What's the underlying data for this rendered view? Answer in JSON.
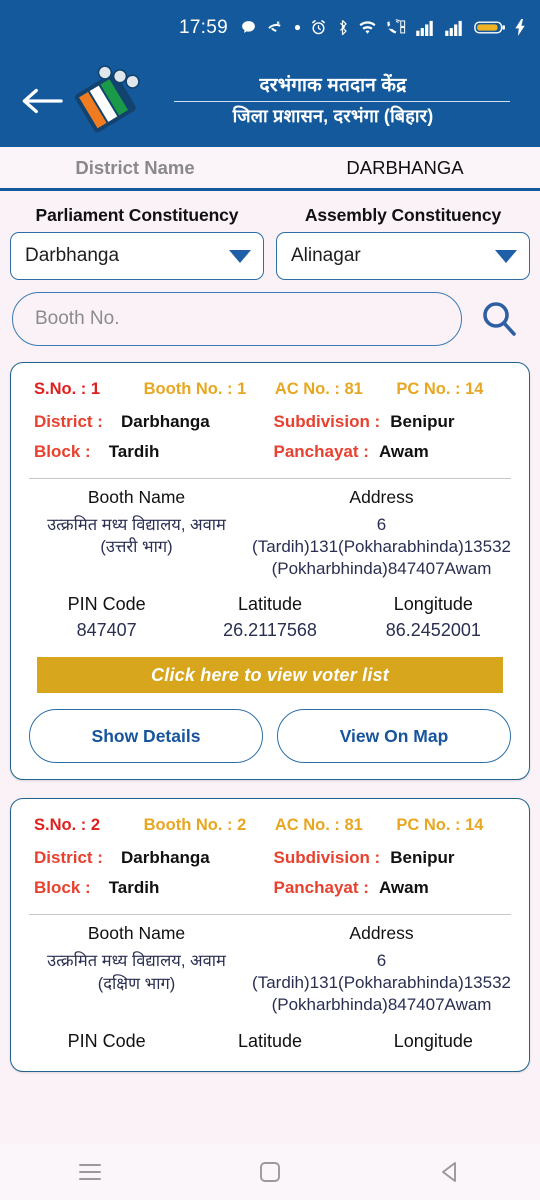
{
  "status_bar": {
    "time": "17:59",
    "icons": [
      "message-bubble-icon",
      "missed-call-icon",
      "dot-icon",
      "alarm-clock-icon",
      "bluetooth-icon",
      "wifi-icon",
      "volte-icon",
      "signal-bars-1-icon",
      "signal-bars-2-icon",
      "battery-icon",
      "charging-bolt-icon"
    ],
    "battery_color": "#f0b323"
  },
  "header": {
    "back_label": "Back",
    "logo_name": "election-commission-logo",
    "title": "दरभंगाक मतदान केंद्र",
    "subtitle": "जिला प्रशासन, दरभंगा (बिहार)",
    "bg_color": "#14599b"
  },
  "district_row": {
    "label": "District Name",
    "value": "DARBHANGA"
  },
  "filters": {
    "parliament": {
      "label": "Parliament Constituency",
      "selected": "Darbhanga"
    },
    "assembly": {
      "label": "Assembly Constituency",
      "selected": "Alinagar"
    },
    "search": {
      "placeholder": "Booth No.",
      "value": "",
      "icon": "search-icon"
    }
  },
  "cards": [
    {
      "sno_label": "S.No. : 1",
      "booth_no_label": "Booth No. : 1",
      "ac_no_label": "AC No. : 81",
      "pc_no_label": "PC No. : 14",
      "district_label": "District :",
      "district_value": "Darbhanga",
      "subdivision_label": "Subdivision :",
      "subdivision_value": "Benipur",
      "block_label": "Block :",
      "block_value": "Tardih",
      "panchayat_label": "Panchayat :",
      "panchayat_value": "Awam",
      "booth_name_head": "Booth Name",
      "booth_name_value": "उत्क्रमित मध्य विद्यालय, अवाम (उत्तरी भाग)",
      "address_head": "Address",
      "address_value": "6 (Tardih)131(Pokharabhinda)13532 (Pokharbhinda)847407Awam",
      "pin_head": "PIN Code",
      "pin_value": "847407",
      "lat_head": "Latitude",
      "lat_value": "26.2117568",
      "lon_head": "Longitude",
      "lon_value": "86.2452001",
      "voter_btn": "Click here to view voter list",
      "show_details_btn": "Show Details",
      "view_map_btn": "View On Map"
    },
    {
      "sno_label": "S.No. : 2",
      "booth_no_label": "Booth No. : 2",
      "ac_no_label": "AC No. : 81",
      "pc_no_label": "PC No. : 14",
      "district_label": "District :",
      "district_value": "Darbhanga",
      "subdivision_label": "Subdivision :",
      "subdivision_value": "Benipur",
      "block_label": "Block :",
      "block_value": "Tardih",
      "panchayat_label": "Panchayat :",
      "panchayat_value": "Awam",
      "booth_name_head": "Booth Name",
      "booth_name_value": "उत्क्रमित मध्य विद्यालय, अवाम (दक्षिण भाग)",
      "address_head": "Address",
      "address_value": "6 (Tardih)131(Pokharabhinda)13532 (Pokharbhinda)847407Awam",
      "pin_head": "PIN Code",
      "lat_head": "Latitude",
      "lon_head": "Longitude"
    }
  ],
  "nav_bar": {
    "recents": "recents-icon",
    "home": "home-icon",
    "back": "back-icon"
  },
  "colors": {
    "primary_blue": "#14599b",
    "card_border": "#20638f",
    "label_red": "#e8412f",
    "label_amber": "#e8a723",
    "gold_button": "#d8a61d",
    "value_navy": "#2a2f52",
    "page_bg": "#faf2f7"
  }
}
